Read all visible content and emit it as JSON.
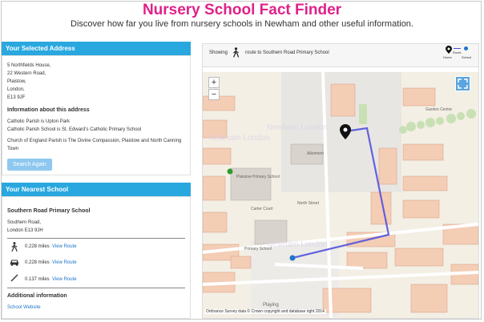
{
  "header": {
    "title": "Nursery School Fact Finder",
    "subtitle": "Discover how far you live from nursery schools in Newham and other useful information."
  },
  "address_panel": {
    "heading": "Your Selected Address",
    "address_lines": [
      "5 Northfields House,",
      "22 Western Road,",
      "Plaistow,",
      "London,",
      "E13 9JF"
    ],
    "info_heading": "Information about this address",
    "info_lines": [
      "Catholic Parish is Upton Park",
      "Catholic Parish School is St. Edward's Catholic Primary School",
      "Church of England Parish is The Divine Compassion, Plaistow and North Canning",
      "Town"
    ],
    "search_again": "Search Again"
  },
  "school_panel": {
    "heading": "Your Nearest School",
    "school_name": "Southern Road Primary School",
    "school_lines": [
      "Southern Road,",
      "London E13 9JH"
    ],
    "routes": [
      {
        "icon": "walking-icon",
        "distance": "0.228 miles",
        "link": "View Route"
      },
      {
        "icon": "car-icon",
        "distance": "0.228 miles",
        "link": "View Route"
      },
      {
        "icon": "straight-line-icon",
        "distance": "0.137 miles",
        "link": "View Route"
      }
    ],
    "additional_heading": "Additional information",
    "school_website": "School Website"
  },
  "map": {
    "showing_label": "Showing",
    "route_label": "route to Southern Road Primary School",
    "legend_route": "Route",
    "legend_home": "Home",
    "legend_school": "School",
    "zoom_in": "+",
    "zoom_out": "−",
    "attribution": "Ordnance Survey data © Crown copyright and database right 2014",
    "labels": {
      "watermark_a": "Newham London",
      "watermark_b": "Newham London",
      "watermark_c": "Newham London",
      "allotment": "Allotment",
      "plaistow_primary": "Plaistow Primary School",
      "primary_school": "Primary School",
      "north_street": "North Street",
      "carter_court": "Carter Court",
      "garden_centre": "Garden Centre",
      "playing": "Playing"
    },
    "colors": {
      "route": "#4a4adf",
      "home": "#1f74c9",
      "school": "#2e9a2e",
      "accent": "#29a7df",
      "title": "#e0218a"
    }
  }
}
